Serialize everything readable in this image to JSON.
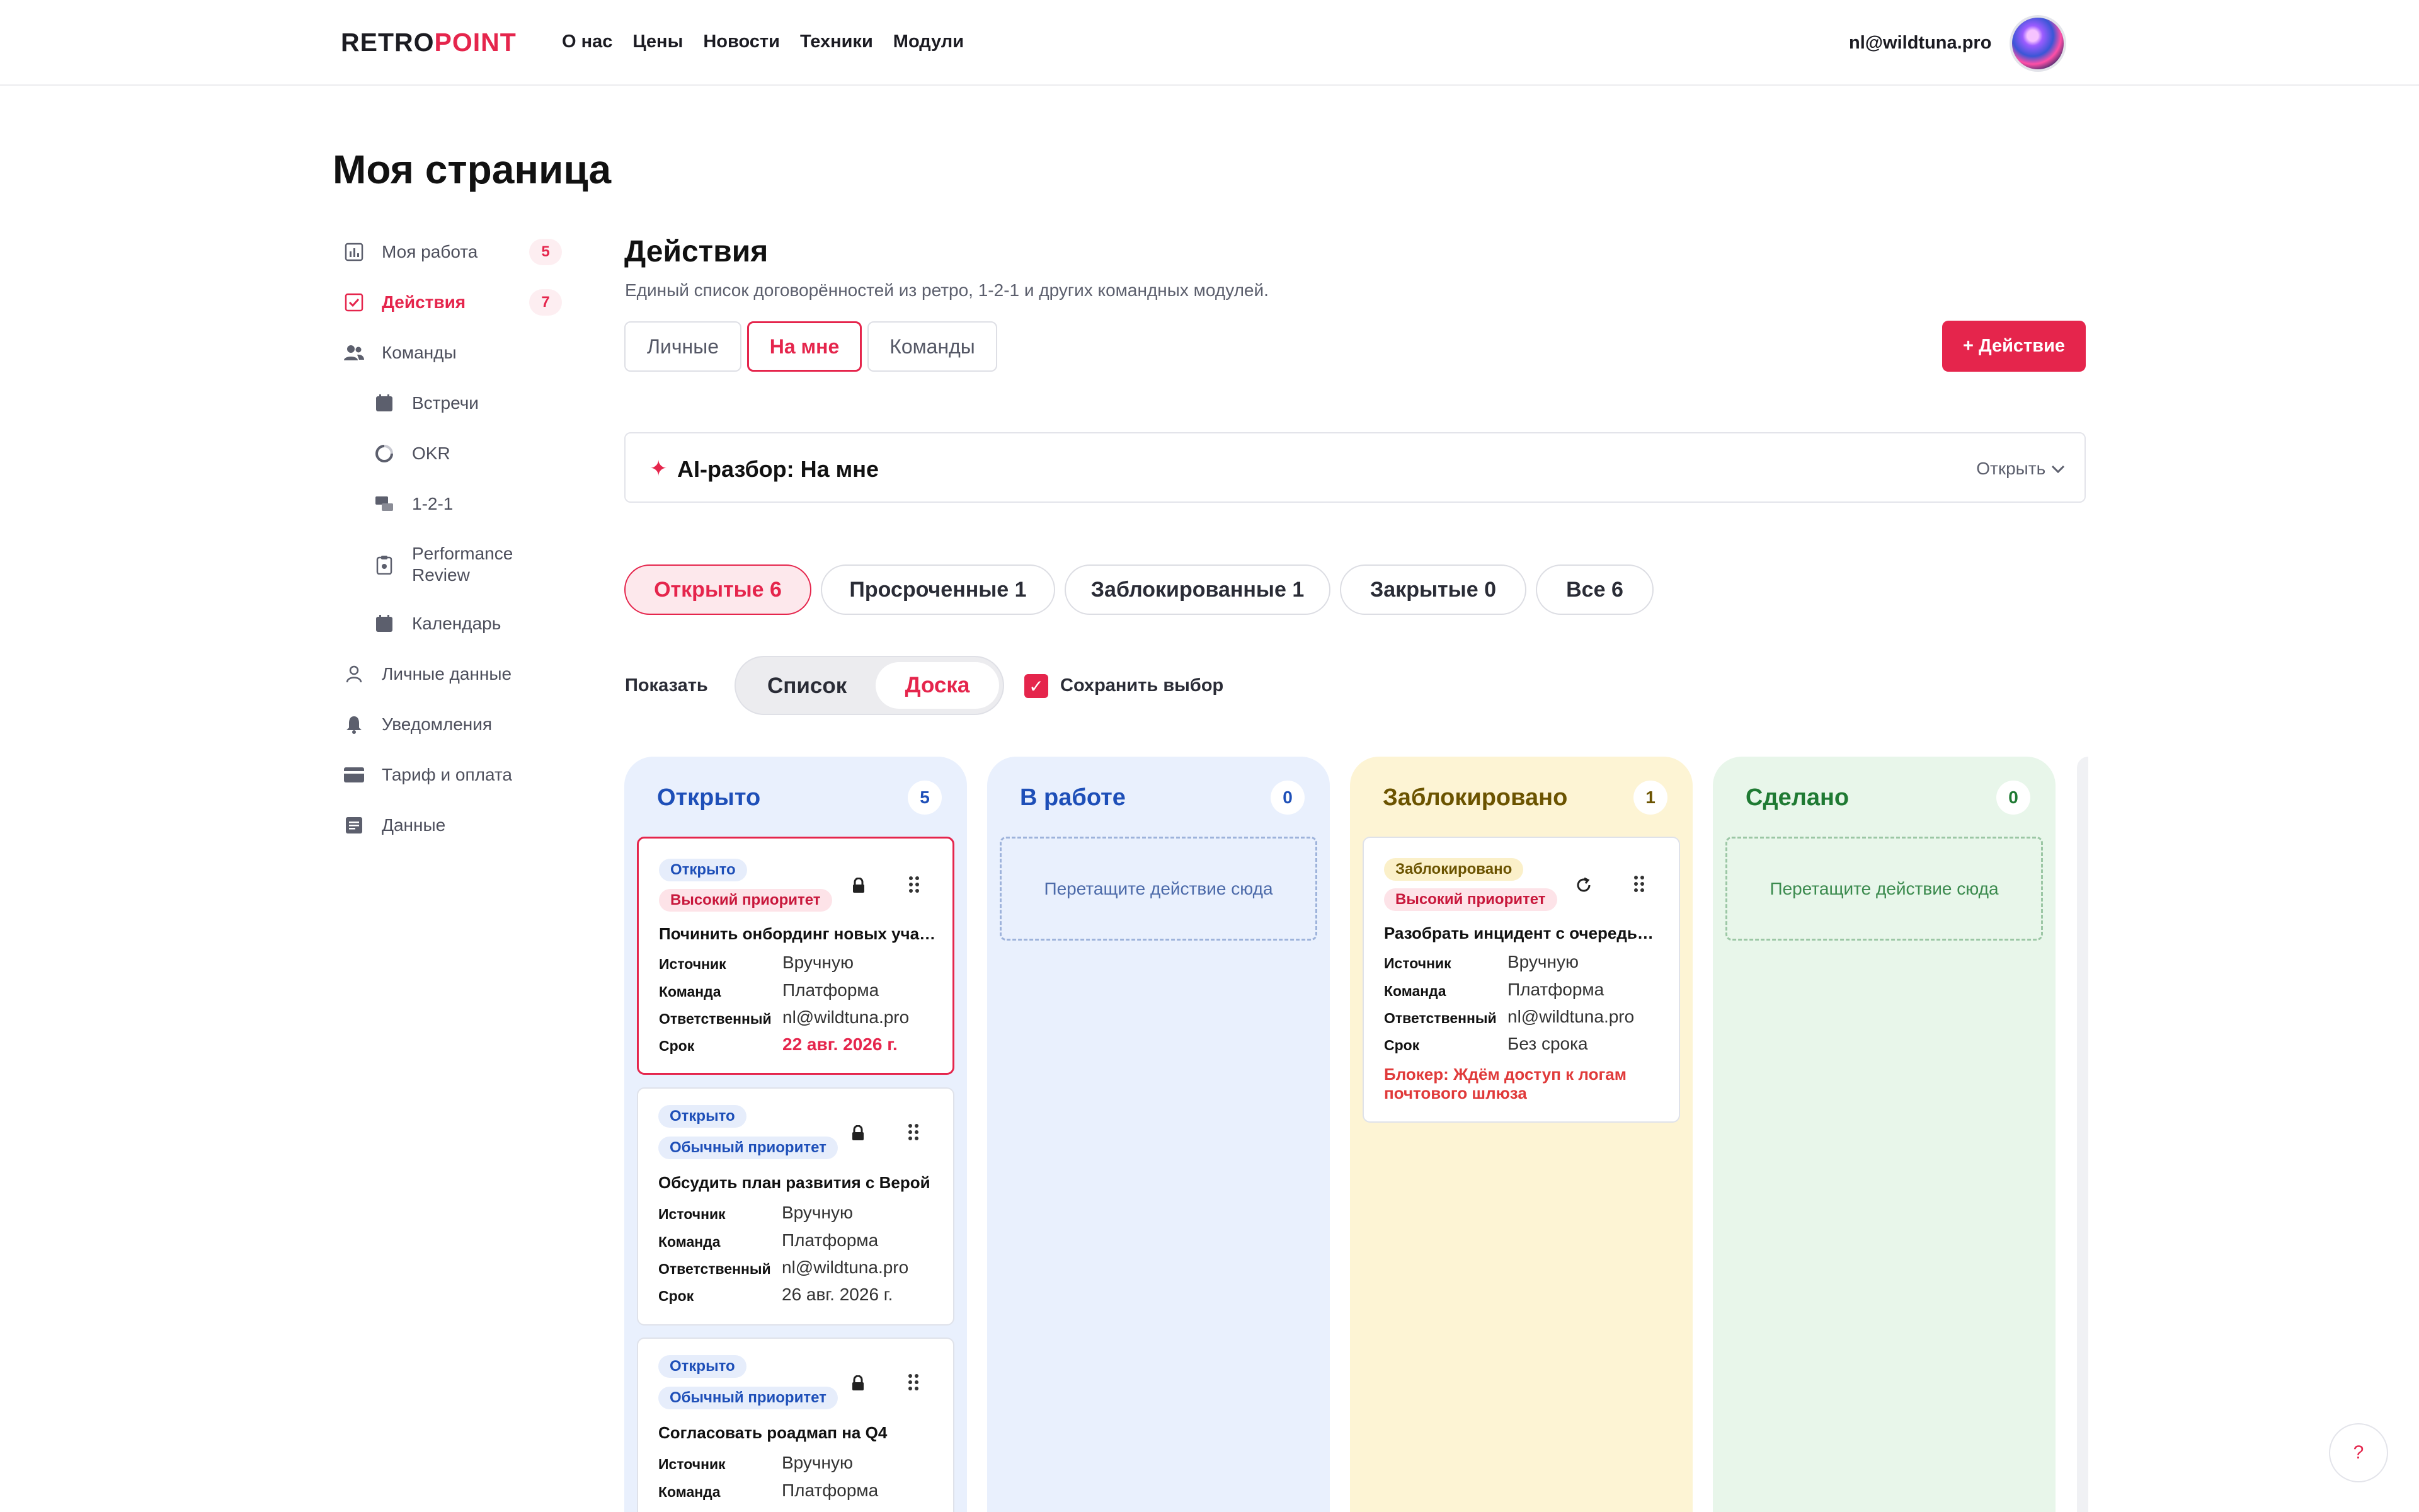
{
  "header": {
    "logo_part1": "RETRO",
    "logo_part2": "POINT",
    "nav": [
      "О нас",
      "Цены",
      "Новости",
      "Техники",
      "Модули"
    ],
    "user_email": "nl@wildtuna.pro"
  },
  "page": {
    "title": "Моя страница"
  },
  "sidebar": {
    "items": [
      {
        "label": "Моя работа",
        "badge": "5",
        "icon": "chart-icon"
      },
      {
        "label": "Действия",
        "badge": "7",
        "icon": "checkbox-icon"
      },
      {
        "label": "Команды",
        "icon": "users-icon"
      },
      {
        "label": "Встречи",
        "icon": "calendar-icon"
      },
      {
        "label": "OKR",
        "icon": "progress-circle-icon"
      },
      {
        "label": "1-2-1",
        "icon": "chat-icon"
      },
      {
        "label": "Performance Review",
        "icon": "clipboard-icon"
      },
      {
        "label": "Календарь",
        "icon": "calendar-icon"
      },
      {
        "label": "Личные данные",
        "icon": "user-icon"
      },
      {
        "label": "Уведомления",
        "icon": "bell-icon"
      },
      {
        "label": "Тариф и оплата",
        "icon": "card-icon"
      },
      {
        "label": "Данные",
        "icon": "document-icon"
      }
    ]
  },
  "main": {
    "title": "Действия",
    "subtitle": "Единый список договорённостей из ретро, 1-2-1 и других командных модулей.",
    "scope_tabs": [
      "Личные",
      "На мне",
      "Команды"
    ],
    "add_button": "+ Действие",
    "ai": {
      "title": "AI-разбор: На мне",
      "open_label": "Открыть"
    },
    "filters": [
      "Открытые 6",
      "Просроченные 1",
      "Заблокированные 1",
      "Закрытые 0",
      "Все 6"
    ],
    "show_label": "Показать",
    "view_list": "Список",
    "view_board": "Доска",
    "save_choice": "Сохранить выбор"
  },
  "board": {
    "drop_text": "Перетащите действие сюда",
    "columns": [
      {
        "title": "Открыто",
        "count": "5",
        "cards": [
          {
            "status": "Открыто",
            "priority": "Высокий приоритет",
            "title": "Починить онбординг новых учасников",
            "source_k": "Источник",
            "source": "Вручную",
            "team_k": "Команда",
            "team": "Платформа",
            "owner_k": "Ответственный",
            "owner": "nl@wildtuna.pro",
            "due_k": "Срок",
            "due": "22 авг. 2026 г."
          },
          {
            "status": "Открыто",
            "priority": "Обычный приоритет",
            "title": "Обсудить план развития с Верой",
            "source_k": "Источник",
            "source": "Вручную",
            "team_k": "Команда",
            "team": "Платформа",
            "owner_k": "Ответственный",
            "owner": "nl@wildtuna.pro",
            "due_k": "Срок",
            "due": "26 авг. 2026 г."
          },
          {
            "status": "Открыто",
            "priority": "Обычный приоритет",
            "title": "Согласовать роадмап на Q4",
            "source_k": "Источник",
            "source": "Вручную",
            "team_k": "Команда",
            "team": "Платформа"
          }
        ]
      },
      {
        "title": "В работе",
        "count": "0"
      },
      {
        "title": "Заблокировано",
        "count": "1",
        "cards": [
          {
            "status": "Заблокировано",
            "priority": "Высокий приоритет",
            "title": "Разобрать инцидент с очередью писем",
            "source_k": "Источник",
            "source": "Вручную",
            "team_k": "Команда",
            "team": "Платформа",
            "owner_k": "Ответственный",
            "owner": "nl@wildtuna.pro",
            "due_k": "Срок",
            "due": "Без срока",
            "blocker": "Блокер: Ждём доступ к логам почтового шлюза"
          }
        ]
      },
      {
        "title": "Сделано",
        "count": "0"
      }
    ]
  },
  "help_label": "?",
  "colors": {
    "accent": "#e5254c",
    "open_blue": "#1e4fb8",
    "blocked_yellow": "#fdf4d4",
    "done_green": "#e8f6ea"
  }
}
